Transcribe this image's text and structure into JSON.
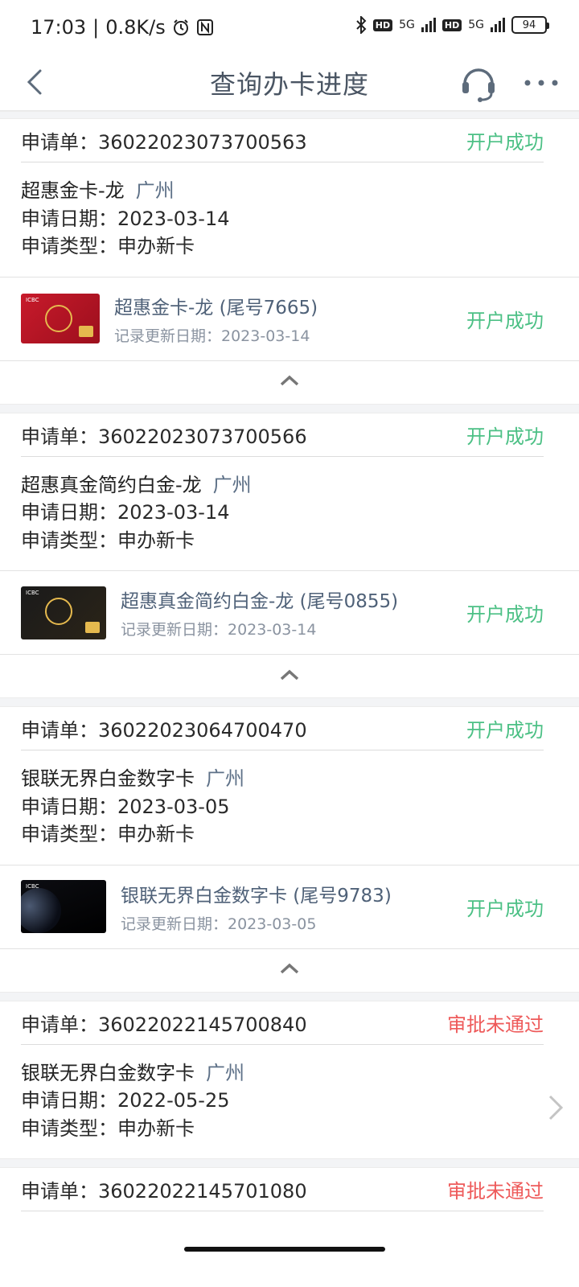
{
  "status_bar": {
    "time": "17:03",
    "separator": "|",
    "net_speed": "0.8K/s",
    "signal1_label": "5G",
    "signal2_label": "5G",
    "battery": "94"
  },
  "nav": {
    "title": "查询办卡进度"
  },
  "labels": {
    "app_no_prefix": "申请单：",
    "date_prefix": "申请日期：",
    "type_prefix": "申请类型："
  },
  "applications": [
    {
      "app_no": "36022023073700563",
      "status": "开户成功",
      "status_kind": "ok",
      "product": "超惠金卡-龙",
      "city": "广州",
      "date": "2023-03-14",
      "type": "申办新卡",
      "card_line": "超惠金卡-龙 (尾号7665)",
      "card_updated": "记录更新日期：2023-03-14",
      "card_status": "开户成功",
      "card_style": "red"
    },
    {
      "app_no": "36022023073700566",
      "status": "开户成功",
      "status_kind": "ok",
      "product": "超惠真金简约白金-龙",
      "city": "广州",
      "date": "2023-03-14",
      "type": "申办新卡",
      "card_line": "超惠真金简约白金-龙 (尾号0855)",
      "card_updated": "记录更新日期：2023-03-14",
      "card_status": "开户成功",
      "card_style": "black"
    },
    {
      "app_no": "36022023064700470",
      "status": "开户成功",
      "status_kind": "ok",
      "product": "银联无界白金数字卡",
      "city": "广州",
      "date": "2023-03-05",
      "type": "申办新卡",
      "card_line": "银联无界白金数字卡 (尾号9783)",
      "card_updated": "记录更新日期：2023-03-05",
      "card_status": "开户成功",
      "card_style": "space"
    },
    {
      "app_no": "36022022145700840",
      "status": "审批未通过",
      "status_kind": "fail",
      "product": "银联无界白金数字卡",
      "city": "广州",
      "date": "2022-05-25",
      "type": "申办新卡"
    },
    {
      "app_no": "36022022145701080",
      "status": "审批未通过",
      "status_kind": "fail"
    }
  ],
  "colors": {
    "success": "#4cc085",
    "fail": "#ee5a5a",
    "title": "#4a5563",
    "city": "#5d7087"
  }
}
